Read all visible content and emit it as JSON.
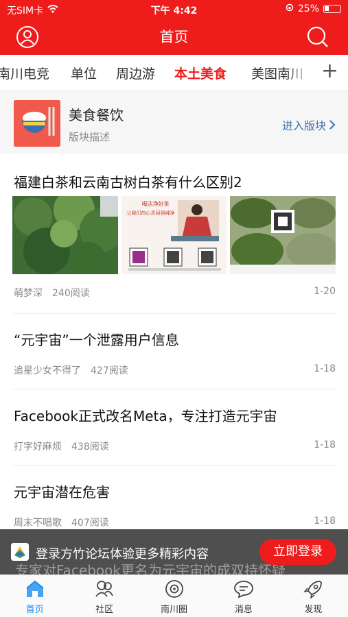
{
  "status": {
    "carrier": "无SIM卡",
    "time": "下午 4:42",
    "battery": "25%"
  },
  "header": {
    "title": "首页"
  },
  "tabs": {
    "items": [
      {
        "label": "南川电竞"
      },
      {
        "label": "单位"
      },
      {
        "label": "周边游"
      },
      {
        "label": "本土美食"
      },
      {
        "label": "美图南川"
      }
    ],
    "active_index": 3,
    "more_label": "+"
  },
  "block": {
    "name": "美食餐饮",
    "desc": "版块描述",
    "enter_label": "进入版块"
  },
  "posts": [
    {
      "title": "福建白茶和云南古树白茶有什么区别2",
      "author": "萌梦深",
      "reads": "240阅读",
      "date": "1-20",
      "thumb_texts": {
        "t2_line1": "喝洁净好茶",
        "t2_line2": "让我们的心灵回到纯净"
      }
    },
    {
      "title": "“元宇宙”一个泄露用户信息",
      "author": "追星少女不得了",
      "reads": "427阅读",
      "date": "1-18"
    },
    {
      "title": "Facebook正式改名Meta，专注打造元宇宙",
      "author": "打字好麻烦",
      "reads": "438阅读",
      "date": "1-18"
    },
    {
      "title": "元宇宙潜在危害",
      "author": "周末不唱歌",
      "reads": "407阅读",
      "date": "1-18"
    }
  ],
  "next_post_title": "专家对Facebook更名为元宇宙的成双持怀疑",
  "banner": {
    "text": "登录方竹论坛体验更多精彩内容",
    "button": "立即登录"
  },
  "bottom_nav": [
    {
      "label": "首页",
      "icon": "home-icon"
    },
    {
      "label": "社区",
      "icon": "community-icon"
    },
    {
      "label": "南川圈",
      "icon": "circle-icon"
    },
    {
      "label": "消息",
      "icon": "message-icon"
    },
    {
      "label": "发现",
      "icon": "rocket-icon"
    }
  ],
  "colors": {
    "brand_red": "#ef1c1c",
    "link_blue": "#3b6fb5",
    "nav_active": "#1b8ae8"
  }
}
